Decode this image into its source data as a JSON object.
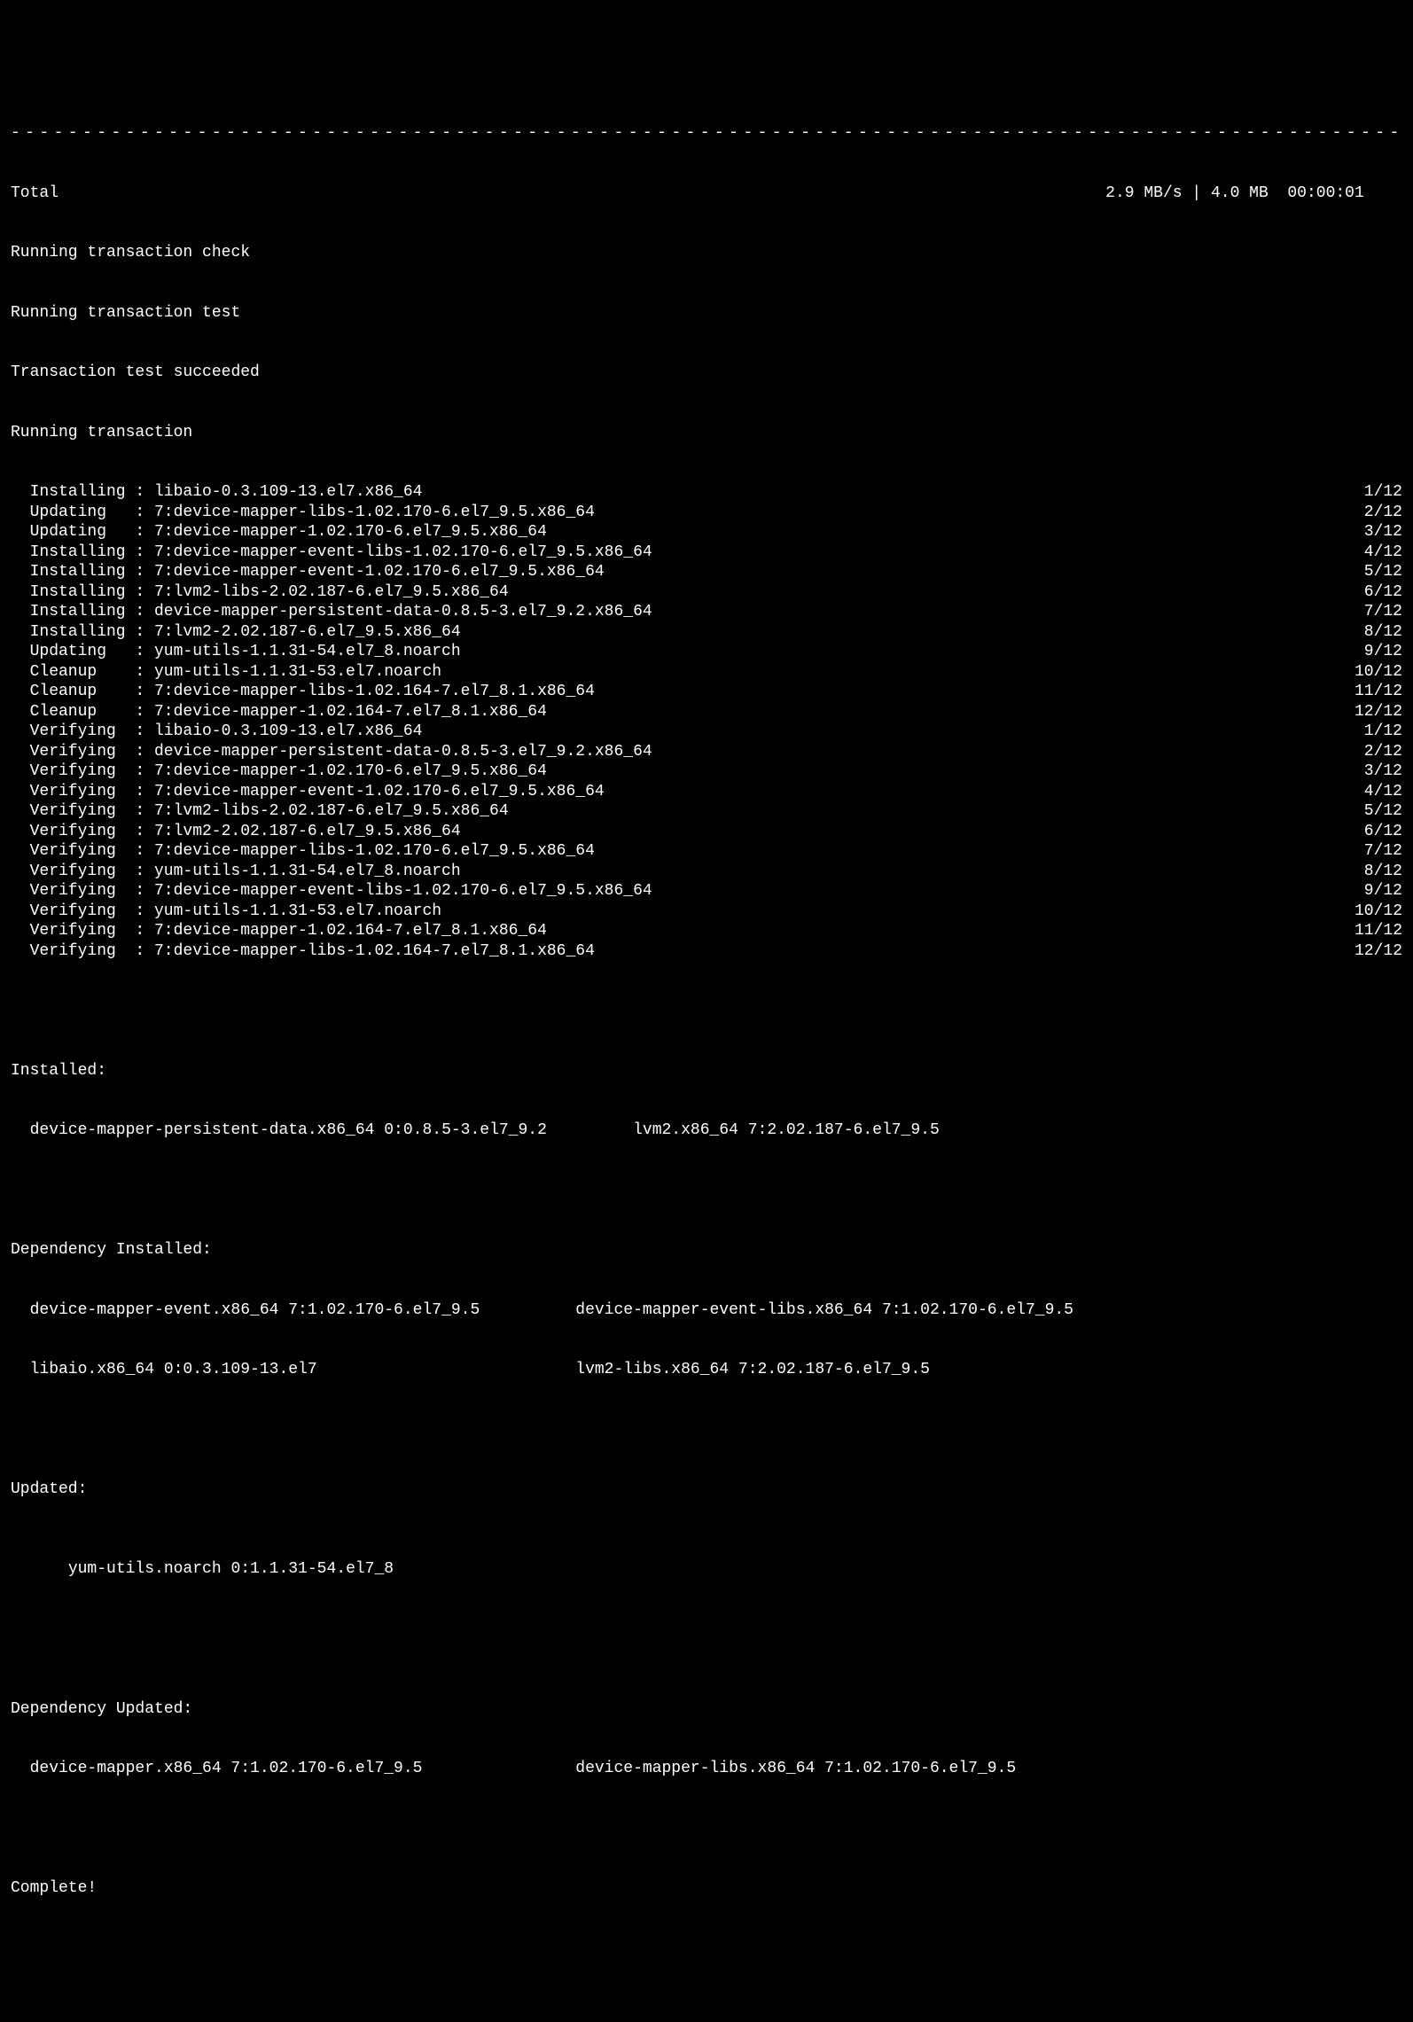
{
  "dashes": "-----------------------------------------------------------------------------------------------------------------------------",
  "total_label": "Total",
  "total_stats": "2.9 MB/s | 4.0 MB  00:00:01",
  "msg_check": "Running transaction check",
  "msg_test": "Running transaction test",
  "msg_test_ok": "Transaction test succeeded",
  "msg_running": "Running transaction",
  "actions": [
    {
      "name": "Installing",
      "pkg": "libaio-0.3.109-13.el7.x86_64",
      "count": "1/12"
    },
    {
      "name": "Updating",
      "pkg": "7:device-mapper-libs-1.02.170-6.el7_9.5.x86_64",
      "count": "2/12"
    },
    {
      "name": "Updating",
      "pkg": "7:device-mapper-1.02.170-6.el7_9.5.x86_64",
      "count": "3/12"
    },
    {
      "name": "Installing",
      "pkg": "7:device-mapper-event-libs-1.02.170-6.el7_9.5.x86_64",
      "count": "4/12"
    },
    {
      "name": "Installing",
      "pkg": "7:device-mapper-event-1.02.170-6.el7_9.5.x86_64",
      "count": "5/12"
    },
    {
      "name": "Installing",
      "pkg": "7:lvm2-libs-2.02.187-6.el7_9.5.x86_64",
      "count": "6/12"
    },
    {
      "name": "Installing",
      "pkg": "device-mapper-persistent-data-0.8.5-3.el7_9.2.x86_64",
      "count": "7/12"
    },
    {
      "name": "Installing",
      "pkg": "7:lvm2-2.02.187-6.el7_9.5.x86_64",
      "count": "8/12"
    },
    {
      "name": "Updating",
      "pkg": "yum-utils-1.1.31-54.el7_8.noarch",
      "count": "9/12"
    },
    {
      "name": "Cleanup",
      "pkg": "yum-utils-1.1.31-53.el7.noarch",
      "count": "10/12"
    },
    {
      "name": "Cleanup",
      "pkg": "7:device-mapper-libs-1.02.164-7.el7_8.1.x86_64",
      "count": "11/12"
    },
    {
      "name": "Cleanup",
      "pkg": "7:device-mapper-1.02.164-7.el7_8.1.x86_64",
      "count": "12/12"
    },
    {
      "name": "Verifying",
      "pkg": "libaio-0.3.109-13.el7.x86_64",
      "count": "1/12"
    },
    {
      "name": "Verifying",
      "pkg": "device-mapper-persistent-data-0.8.5-3.el7_9.2.x86_64",
      "count": "2/12"
    },
    {
      "name": "Verifying",
      "pkg": "7:device-mapper-1.02.170-6.el7_9.5.x86_64",
      "count": "3/12"
    },
    {
      "name": "Verifying",
      "pkg": "7:device-mapper-event-1.02.170-6.el7_9.5.x86_64",
      "count": "4/12"
    },
    {
      "name": "Verifying",
      "pkg": "7:lvm2-libs-2.02.187-6.el7_9.5.x86_64",
      "count": "5/12"
    },
    {
      "name": "Verifying",
      "pkg": "7:lvm2-2.02.187-6.el7_9.5.x86_64",
      "count": "6/12"
    },
    {
      "name": "Verifying",
      "pkg": "7:device-mapper-libs-1.02.170-6.el7_9.5.x86_64",
      "count": "7/12"
    },
    {
      "name": "Verifying",
      "pkg": "yum-utils-1.1.31-54.el7_8.noarch",
      "count": "8/12"
    },
    {
      "name": "Verifying",
      "pkg": "7:device-mapper-event-libs-1.02.170-6.el7_9.5.x86_64",
      "count": "9/12"
    },
    {
      "name": "Verifying",
      "pkg": "yum-utils-1.1.31-53.el7.noarch",
      "count": "10/12"
    },
    {
      "name": "Verifying",
      "pkg": "7:device-mapper-1.02.164-7.el7_8.1.x86_64",
      "count": "11/12"
    },
    {
      "name": "Verifying",
      "pkg": "7:device-mapper-libs-1.02.164-7.el7_8.1.x86_64",
      "count": "12/12"
    }
  ],
  "installed_header": "Installed:",
  "installed": {
    "col1": "device-mapper-persistent-data.x86_64 0:0.8.5-3.el7_9.2",
    "col2": "lvm2.x86_64 7:2.02.187-6.el7_9.5"
  },
  "dep_installed_header": "Dependency Installed:",
  "dep_installed_row1": {
    "col1": "device-mapper-event.x86_64 7:1.02.170-6.el7_9.5",
    "col2": "device-mapper-event-libs.x86_64 7:1.02.170-6.el7_9.5"
  },
  "dep_installed_row2": {
    "col1": "libaio.x86_64 0:0.3.109-13.el7",
    "col2": "lvm2-libs.x86_64 7:2.02.187-6.el7_9.5"
  },
  "updated_header": "Updated:",
  "updated": {
    "col1": "yum-utils.noarch 0:1.1.31-54.el7_8"
  },
  "dep_updated_header": "Dependency Updated:",
  "dep_updated": {
    "col1": "device-mapper.x86_64 7:1.02.170-6.el7_9.5",
    "col2": "device-mapper-libs.x86_64 7:1.02.170-6.el7_9.5"
  },
  "complete": "Complete!"
}
